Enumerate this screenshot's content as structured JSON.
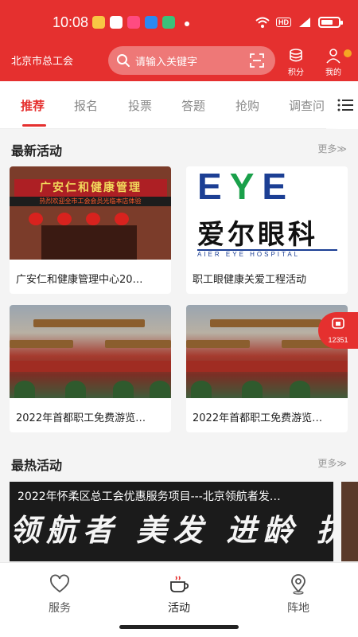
{
  "status_bar": {
    "time": "10:08",
    "hd": "HD"
  },
  "header": {
    "org_name": "北京市总工会",
    "search_placeholder": "请输入关键字",
    "points_label": "积分",
    "mine_label": "我的"
  },
  "tabs": [
    "推荐",
    "报名",
    "投票",
    "答题",
    "抢购",
    "调查问"
  ],
  "latest": {
    "title": "最新活动",
    "more": "更多≫",
    "cards": [
      {
        "caption": "广安仁和健康管理中心20…",
        "image_text": "广安仁和健康管理",
        "image_subtext": "热烈欢迎全市工会会员光临本店体验"
      },
      {
        "caption": "职工眼健康关爱工程活动",
        "image_text": "爱尔眼科",
        "image_logo": "EYE",
        "image_subtext": "AIER EYE HOSPITAL"
      },
      {
        "caption": "2022年首都职工免费游览…"
      },
      {
        "caption": "2022年首都职工免费游览…"
      }
    ]
  },
  "hot": {
    "title": "最热活动",
    "more": "更多≫",
    "banner_caption": "2022年怀柔区总工会优惠服务项目---北京领航者发…",
    "banner_art": "领航者 美发 进龄 抗"
  },
  "float_phone": {
    "number": "12351"
  },
  "bottom_nav": [
    {
      "label": "服务",
      "icon": "heart-icon"
    },
    {
      "label": "活动",
      "icon": "coffee-cup-icon"
    },
    {
      "label": "阵地",
      "icon": "location-pin-icon"
    }
  ],
  "colors": {
    "brand": "#e5302f",
    "accent_dot": "#f5a623"
  }
}
